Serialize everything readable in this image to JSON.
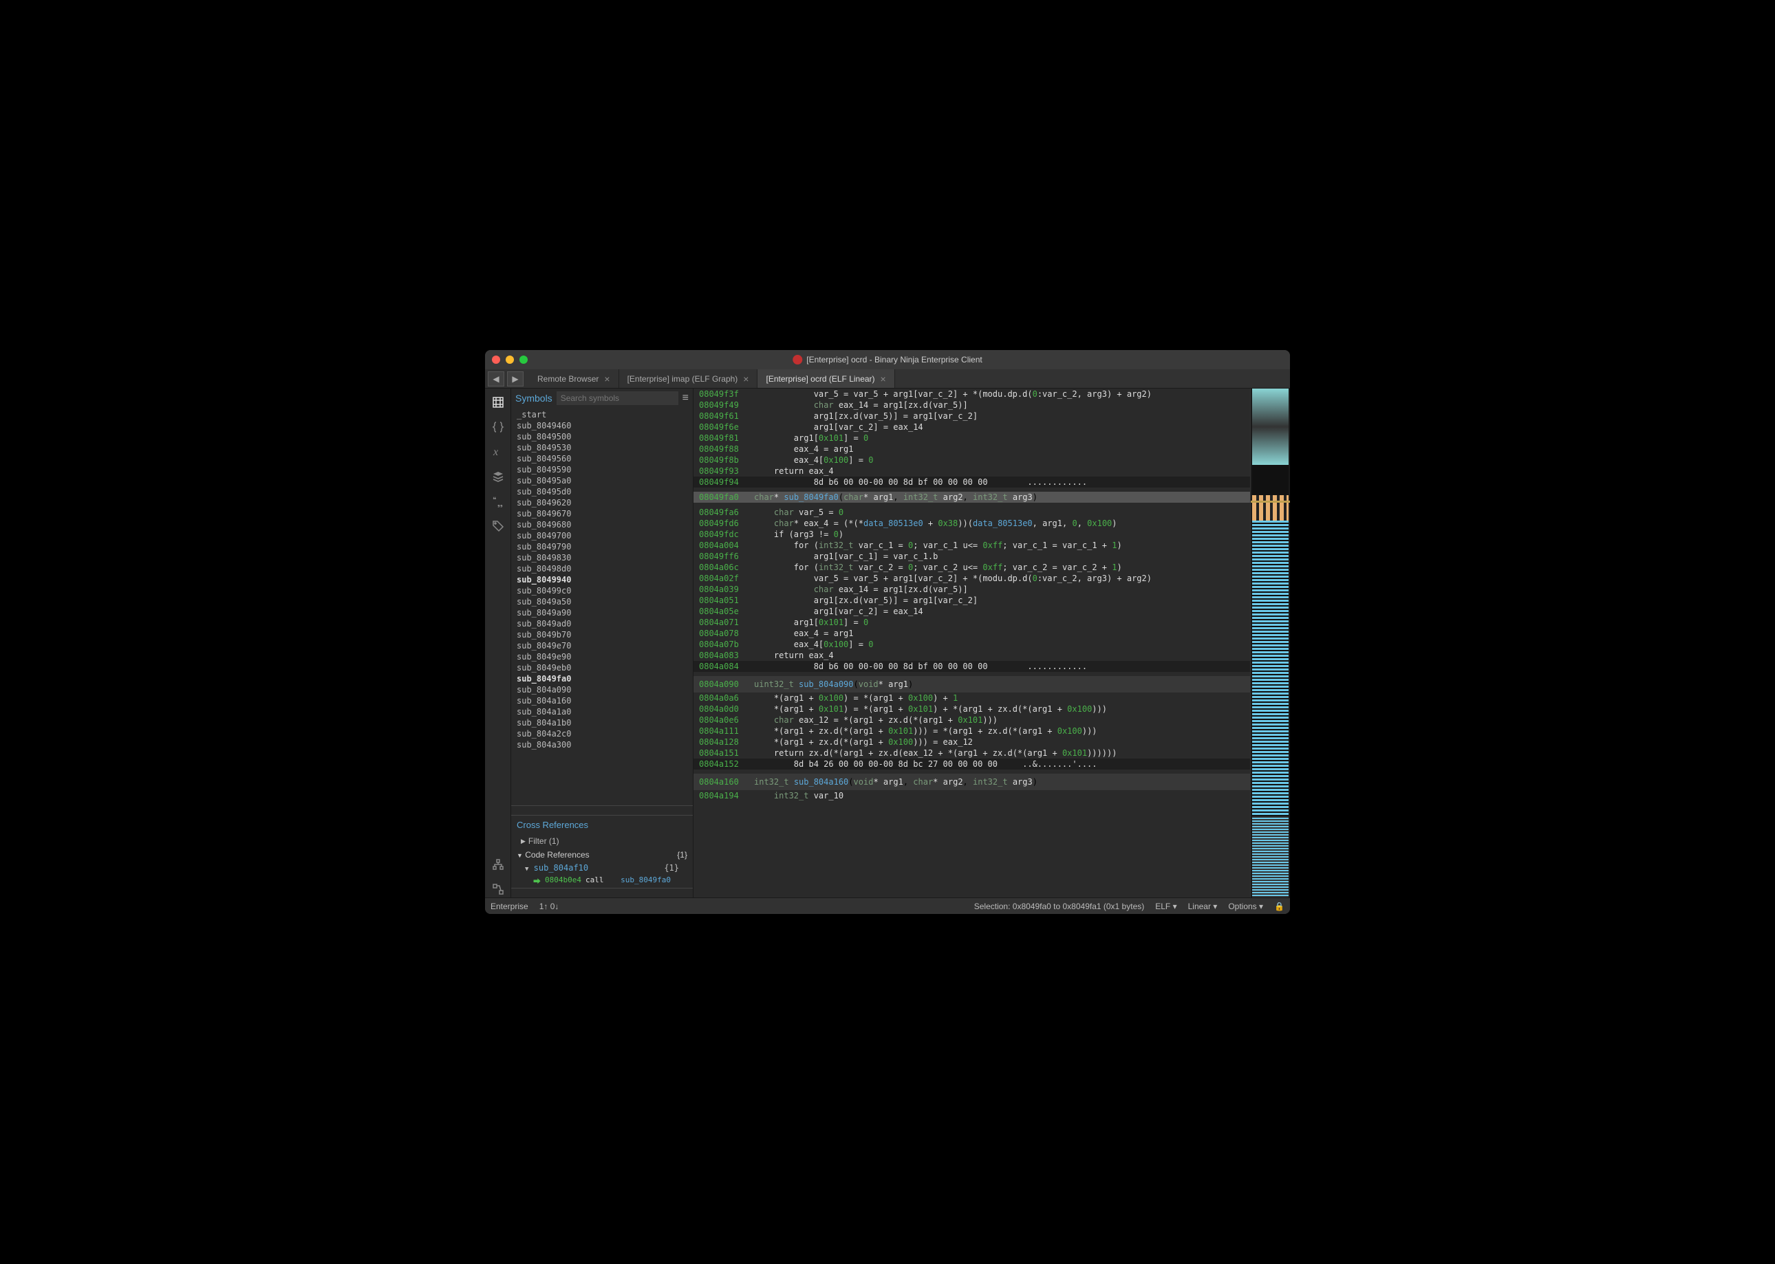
{
  "window": {
    "title": "[Enterprise] ocrd - Binary Ninja Enterprise Client"
  },
  "tabs": [
    {
      "label": "Remote Browser",
      "active": false
    },
    {
      "label": "[Enterprise] imap (ELF Graph)",
      "active": false
    },
    {
      "label": "[Enterprise] ocrd (ELF Linear)",
      "active": true
    }
  ],
  "sidebar": {
    "symbols_title": "Symbols",
    "search_placeholder": "Search symbols",
    "symbols": [
      {
        "name": "_start",
        "bold": false
      },
      {
        "name": "sub_8049460",
        "bold": false
      },
      {
        "name": "sub_8049500",
        "bold": false
      },
      {
        "name": "sub_8049530",
        "bold": false
      },
      {
        "name": "sub_8049560",
        "bold": false
      },
      {
        "name": "sub_8049590",
        "bold": false
      },
      {
        "name": "sub_80495a0",
        "bold": false
      },
      {
        "name": "sub_80495d0",
        "bold": false
      },
      {
        "name": "sub_8049620",
        "bold": false
      },
      {
        "name": "sub_8049670",
        "bold": false
      },
      {
        "name": "sub_8049680",
        "bold": false
      },
      {
        "name": "sub_8049700",
        "bold": false
      },
      {
        "name": "sub_8049790",
        "bold": false
      },
      {
        "name": "sub_8049830",
        "bold": false
      },
      {
        "name": "sub_80498d0",
        "bold": false
      },
      {
        "name": "sub_8049940",
        "bold": true
      },
      {
        "name": "sub_80499c0",
        "bold": false
      },
      {
        "name": "sub_8049a50",
        "bold": false
      },
      {
        "name": "sub_8049a90",
        "bold": false
      },
      {
        "name": "sub_8049ad0",
        "bold": false
      },
      {
        "name": "sub_8049b70",
        "bold": false
      },
      {
        "name": "sub_8049e70",
        "bold": false
      },
      {
        "name": "sub_8049e90",
        "bold": false
      },
      {
        "name": "sub_8049eb0",
        "bold": false
      },
      {
        "name": "sub_8049fa0",
        "bold": true
      },
      {
        "name": "sub_804a090",
        "bold": false
      },
      {
        "name": "sub_804a160",
        "bold": false
      },
      {
        "name": "sub_804a1a0",
        "bold": false
      },
      {
        "name": "sub_804a1b0",
        "bold": false
      },
      {
        "name": "sub_804a2c0",
        "bold": false
      },
      {
        "name": "sub_804a300",
        "bold": false
      }
    ],
    "xref_title": "Cross References",
    "xref_filter": "Filter (1)",
    "xref_section": "Code References",
    "xref_count": "{1}",
    "xref_item": "sub_804af10",
    "xref_item_count": "{1}",
    "xref_addr": "0804b0e4",
    "xref_instr": "call",
    "xref_target": "sub_8049fa0"
  },
  "code": {
    "lines": [
      {
        "a": "08049f3f",
        "t": "            var_5 = var_5 + arg1[var_c_2] + *(modu.dp.d(0:var_c_2, arg3) + arg2)"
      },
      {
        "a": "08049f49",
        "t": "            char eax_14 = arg1[zx.d(var_5)]",
        "decl": true
      },
      {
        "a": "08049f61",
        "t": "            arg1[zx.d(var_5)] = arg1[var_c_2]"
      },
      {
        "a": "08049f6e",
        "t": "            arg1[var_c_2] = eax_14"
      },
      {
        "a": "08049f81",
        "t": "        arg1[0x101] = 0"
      },
      {
        "a": "08049f88",
        "t": "        eax_4 = arg1"
      },
      {
        "a": "08049f8b",
        "t": "        eax_4[0x100] = 0"
      },
      {
        "a": "08049f93",
        "t": "    return eax_4"
      },
      {
        "type": "dark",
        "a": "08049f94",
        "t": "            8d b6 00 00-00 00 8d bf 00 00 00 00        ............"
      },
      {
        "type": "highlight",
        "a": "08049fa0",
        "sig": "char* sub_8049fa0(char* arg1, int32_t arg2, int32_t arg3)"
      },
      {
        "a": "08049fa6",
        "t": "    char var_5 = 0",
        "decl": true
      },
      {
        "a": "08049fd6",
        "t": "    char* eax_4 = (*(*data_80513e0 + 0x38))(data_80513e0, arg1, 0, 0x100)",
        "decl": true
      },
      {
        "a": "08049fdc",
        "t": "    if (arg3 != 0)"
      },
      {
        "a": "0804a004",
        "t": "        for (int32_t var_c_1 = 0; var_c_1 u<= 0xff; var_c_1 = var_c_1 + 1)",
        "decl": true
      },
      {
        "a": "08049ff6",
        "t": "            arg1[var_c_1] = var_c_1.b"
      },
      {
        "a": "0804a06c",
        "t": "        for (int32_t var_c_2 = 0; var_c_2 u<= 0xff; var_c_2 = var_c_2 + 1)",
        "decl": true
      },
      {
        "a": "0804a02f",
        "t": "            var_5 = var_5 + arg1[var_c_2] + *(modu.dp.d(0:var_c_2, arg3) + arg2)"
      },
      {
        "a": "0804a039",
        "t": "            char eax_14 = arg1[zx.d(var_5)]",
        "decl": true
      },
      {
        "a": "0804a051",
        "t": "            arg1[zx.d(var_5)] = arg1[var_c_2]"
      },
      {
        "a": "0804a05e",
        "t": "            arg1[var_c_2] = eax_14"
      },
      {
        "a": "0804a071",
        "t": "        arg1[0x101] = 0"
      },
      {
        "a": "0804a078",
        "t": "        eax_4 = arg1"
      },
      {
        "a": "0804a07b",
        "t": "        eax_4[0x100] = 0"
      },
      {
        "a": "0804a083",
        "t": "    return eax_4"
      },
      {
        "type": "dark",
        "a": "0804a084",
        "t": "            8d b6 00 00-00 00 8d bf 00 00 00 00        ............"
      },
      {
        "type": "sep",
        "a": "0804a090",
        "sig": "uint32_t sub_804a090(void* arg1)"
      },
      {
        "a": "0804a0a6",
        "t": "    *(arg1 + 0x100) = *(arg1 + 0x100) + 1"
      },
      {
        "a": "0804a0d0",
        "t": "    *(arg1 + 0x101) = *(arg1 + 0x101) + *(arg1 + zx.d(*(arg1 + 0x100)))"
      },
      {
        "a": "0804a0e6",
        "t": "    char eax_12 = *(arg1 + zx.d(*(arg1 + 0x101)))",
        "decl": true
      },
      {
        "a": "0804a111",
        "t": "    *(arg1 + zx.d(*(arg1 + 0x101))) = *(arg1 + zx.d(*(arg1 + 0x100)))"
      },
      {
        "a": "0804a128",
        "t": "    *(arg1 + zx.d(*(arg1 + 0x100))) = eax_12"
      },
      {
        "a": "0804a151",
        "t": "    return zx.d(*(arg1 + zx.d(eax_12 + *(arg1 + zx.d(*(arg1 + 0x101))))))"
      },
      {
        "type": "dark",
        "a": "0804a152",
        "t": "        8d b4 26 00 00 00-00 8d bc 27 00 00 00 00     ..&.......'...."
      },
      {
        "type": "sep",
        "a": "0804a160",
        "sig": "int32_t sub_804a160(void* arg1, char* arg2, int32_t arg3)"
      },
      {
        "a": "0804a194",
        "t": "    int32_t var_10",
        "decl": true
      }
    ]
  },
  "status": {
    "enterprise": "Enterprise",
    "stats": "1↑ 0↓",
    "selection": "Selection: 0x8049fa0 to 0x8049fa1 (0x1 bytes)",
    "format": "ELF",
    "view": "Linear",
    "options": "Options"
  }
}
